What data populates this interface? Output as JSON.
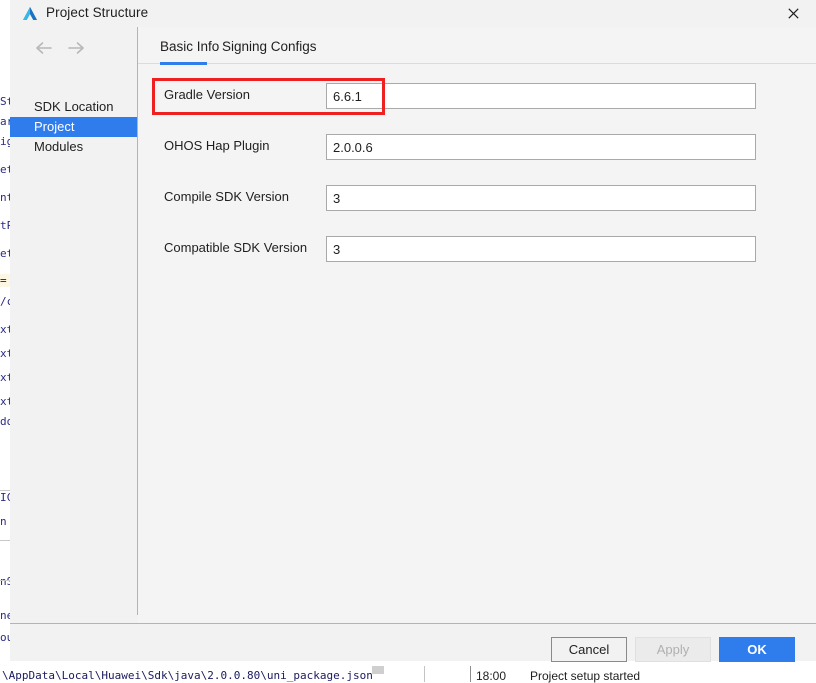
{
  "backdrop": {
    "code_fragments": [
      "St",
      "ar",
      "ig",
      "et",
      "nt",
      "tP",
      "et",
      "=",
      "/c",
      "xt",
      "xt",
      "xt",
      "xt",
      "do",
      "IC",
      "n",
      "nS",
      "ne",
      "ou"
    ],
    "statusbar": {
      "path_text": "\\AppData\\Local\\Huawei\\Sdk\\java\\2.0.0.80\\uni_package.json",
      "time": "18:00",
      "message": "Project setup started"
    }
  },
  "dialog": {
    "title": "Project Structure",
    "logo_icon": "deveco-triangle-icon",
    "close_icon": "close-icon",
    "nav": {
      "back_icon": "arrow-left-icon",
      "forward_icon": "arrow-right-icon",
      "items": [
        {
          "label": "SDK Location",
          "selected": false
        },
        {
          "label": "Project",
          "selected": true
        },
        {
          "label": "Modules",
          "selected": false
        }
      ]
    },
    "tabs": [
      {
        "label": "Basic Info",
        "active": true
      },
      {
        "label": "Signing Configs",
        "active": false
      }
    ],
    "fields": [
      {
        "label": "Gradle Version",
        "value": "6.6.1",
        "placeholder": ""
      },
      {
        "label": "OHOS Hap Plugin",
        "value": "2.0.0.6",
        "placeholder": ""
      },
      {
        "label": "Compile SDK Version",
        "value": "3",
        "placeholder": ""
      },
      {
        "label": "Compatible SDK Version",
        "value": "3",
        "placeholder": ""
      }
    ],
    "buttons": {
      "cancel": "Cancel",
      "apply": "Apply",
      "ok": "OK"
    }
  },
  "colors": {
    "accent_blue": "#2f7ced",
    "annotation_red": "#ef2020",
    "dialog_bg": "#f2f2f2",
    "content_bg": "#f4f4f4",
    "input_bg": "#ffffff",
    "disabled_text": "#b0b0b0"
  }
}
